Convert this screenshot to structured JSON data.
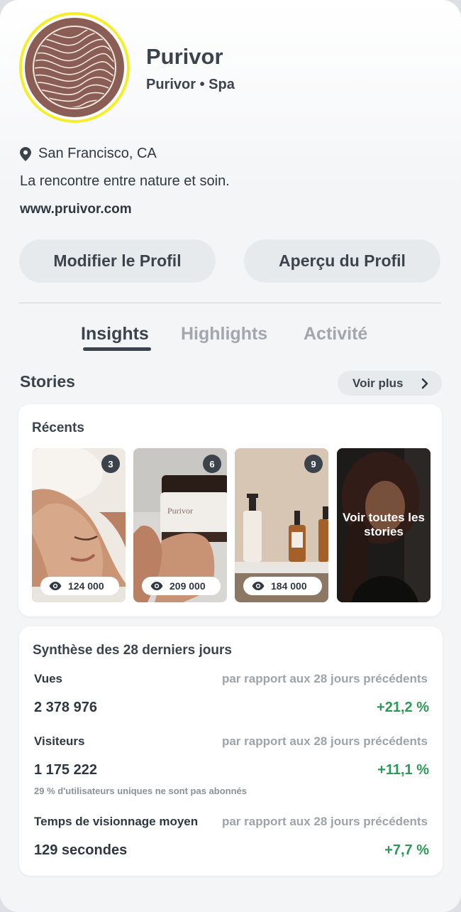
{
  "profile": {
    "name": "Purivor",
    "subtitle": "Purivor • Spa",
    "location": "San Francisco, CA",
    "bio": "La rencontre entre nature et soin.",
    "website": "www.pruivor.com",
    "avatar_icon": "wavy-lines-logo-icon",
    "avatar_color": "#8b5e55",
    "ring_color": "#f5ee2a"
  },
  "actions": {
    "edit_label": "Modifier le Profil",
    "preview_label": "Aperçu du Profil"
  },
  "tabs": [
    {
      "label": "Insights",
      "active": true
    },
    {
      "label": "Highlights",
      "active": false
    },
    {
      "label": "Activité",
      "active": false
    }
  ],
  "stories": {
    "title": "Stories",
    "more_label": "Voir plus",
    "recents_title": "Récents",
    "items": [
      {
        "count": "3",
        "views": "124 000"
      },
      {
        "count": "6",
        "views": "209 000"
      },
      {
        "count": "9",
        "views": "184 000"
      }
    ],
    "see_all_label": "Voir toutes les stories"
  },
  "summary": {
    "title": "Synthèse des 28 derniers jours",
    "metrics": [
      {
        "label": "Vues",
        "compare": "par rapport aux 28 jours précédents",
        "value": "2 378 976",
        "delta": "+21,2 %"
      },
      {
        "label": "Visiteurs",
        "compare": "par rapport aux 28 jours précédents",
        "value": "1 175 222",
        "delta": "+11,1 %",
        "note": "29 % d'utilisateurs uniques ne sont pas abonnés"
      },
      {
        "label": "Temps de visionnage moyen",
        "compare": "par rapport aux 28 jours précédents",
        "value": "129 secondes",
        "delta": "+7,7 %"
      }
    ],
    "positive_color": "#2a9a56"
  }
}
